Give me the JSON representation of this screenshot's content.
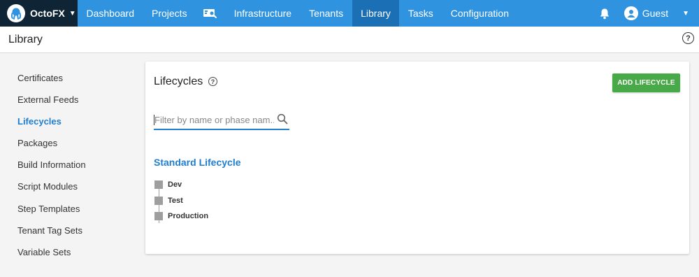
{
  "brand": {
    "name": "OctoFX"
  },
  "nav": {
    "items": [
      {
        "label": "Dashboard",
        "active": false
      },
      {
        "label": "Projects",
        "active": false
      }
    ],
    "items_after_icon": [
      {
        "label": "Infrastructure",
        "active": false
      },
      {
        "label": "Tenants",
        "active": false
      },
      {
        "label": "Library",
        "active": true
      },
      {
        "label": "Tasks",
        "active": false
      },
      {
        "label": "Configuration",
        "active": false
      }
    ],
    "search_icon": "search-monitor-icon",
    "notifications_icon": "bell-icon",
    "user": {
      "name": "Guest",
      "icon": "user-icon"
    }
  },
  "header": {
    "title": "Library",
    "help_icon": "help-circle-icon"
  },
  "sidebar": {
    "items": [
      {
        "label": "Certificates"
      },
      {
        "label": "External Feeds"
      },
      {
        "label": "Lifecycles"
      },
      {
        "label": "Packages"
      },
      {
        "label": "Build Information"
      },
      {
        "label": "Script Modules"
      },
      {
        "label": "Step Templates"
      },
      {
        "label": "Tenant Tag Sets"
      },
      {
        "label": "Variable Sets"
      }
    ],
    "active_index": 2
  },
  "main": {
    "title": "Lifecycles",
    "add_button_label": "ADD LIFECYCLE",
    "filter": {
      "placeholder": "Filter by name or phase nam...",
      "value": ""
    },
    "lifecycles": [
      {
        "name": "Standard Lifecycle",
        "phases": [
          {
            "label": "Dev"
          },
          {
            "label": "Test"
          },
          {
            "label": "Production"
          }
        ]
      }
    ]
  },
  "colors": {
    "nav_bg": "#2f93e0",
    "brand_bg": "#0f2535",
    "nav_active": "#1a6fb5",
    "accent": "#1f7ed0",
    "button_green": "#48a948",
    "phase_grey": "#9e9e9e"
  }
}
